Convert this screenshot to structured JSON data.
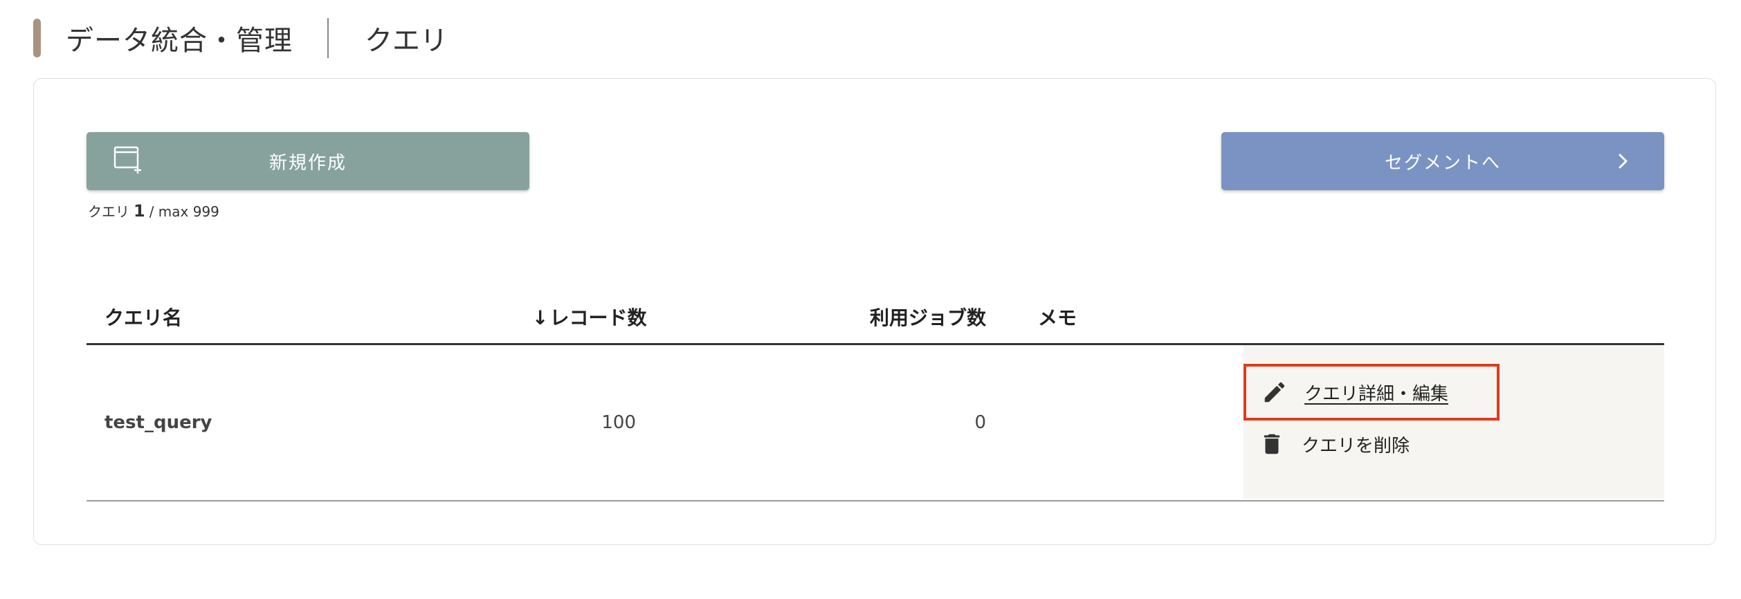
{
  "header": {
    "section_title": "データ統合・管理",
    "page_title": "クエリ"
  },
  "toolbar": {
    "new_button_label": "新規作成",
    "segment_button_label": "セグメントへ"
  },
  "count": {
    "prefix": "クエリ",
    "value": "1",
    "suffix": "/ max 999"
  },
  "table": {
    "columns": {
      "name": "クエリ名",
      "records_arrow": "↓",
      "records": "レコード数",
      "jobs": "利用ジョブ数",
      "memo": "メモ"
    },
    "rows": [
      {
        "name": "test_query",
        "records": "100",
        "jobs": "0",
        "memo": "",
        "actions": {
          "edit_label": "クエリ詳細・編集",
          "delete_label": "クエリを削除"
        }
      }
    ]
  },
  "icons": {
    "new_button_icon": "new-window-plus-icon",
    "segment_button_icon": "chevron-right-icon",
    "edit_icon": "pencil-icon",
    "delete_icon": "trash-icon"
  },
  "colors": {
    "accent_bar": "#a99380",
    "new_button": "#87a29d",
    "segment_button": "#7a93c3",
    "highlight_border": "#e23a1c",
    "action_panel_bg": "#f6f5f1"
  }
}
